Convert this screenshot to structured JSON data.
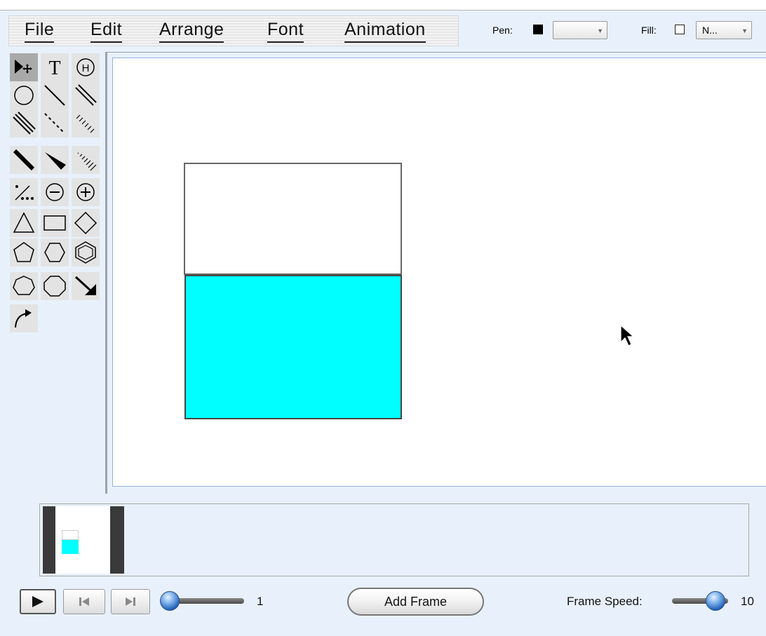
{
  "menu": {
    "file": "File",
    "edit": "Edit",
    "arrange": "Arrange",
    "font": "Font",
    "animation": "Animation"
  },
  "toolbar": {
    "pen_label": "Pen:",
    "pen_color": "#000000",
    "pen_style_value": "",
    "fill_label": "Fill:",
    "fill_color": "#ffffff",
    "fill_value": "N..."
  },
  "tools": [
    {
      "name": "select-tool-icon",
      "selected": true
    },
    {
      "name": "text-tool-icon",
      "glyph": "T"
    },
    {
      "name": "h-circle-icon",
      "glyph": "H"
    },
    {
      "name": "circle-tool-icon"
    },
    {
      "name": "line-thin-icon"
    },
    {
      "name": "line-double-icon"
    },
    {
      "name": "line-triple-icon"
    },
    {
      "name": "line-dashed-icon"
    },
    {
      "name": "line-hatched-icon"
    },
    {
      "name": "line-bold-icon"
    },
    {
      "name": "wedge-icon"
    },
    {
      "name": "wedge-hatched-icon"
    },
    {
      "name": "dots-icon"
    },
    {
      "name": "minus-circle-icon"
    },
    {
      "name": "plus-circle-icon"
    },
    {
      "name": "triangle-icon"
    },
    {
      "name": "rectangle-icon"
    },
    {
      "name": "diamond-icon"
    },
    {
      "name": "pentagon-icon"
    },
    {
      "name": "hexagon-icon"
    },
    {
      "name": "benzene-icon"
    },
    {
      "name": "heptagon-icon"
    },
    {
      "name": "octagon-icon"
    },
    {
      "name": "arrow-icon"
    },
    {
      "name": "curved-arrow-icon"
    }
  ],
  "canvas_shapes": {
    "top_fill": "#ffffff",
    "bottom_fill": "#00ffff"
  },
  "playback": {
    "frame_number": "1",
    "add_frame_label": "Add Frame",
    "frame_speed_label": "Frame Speed:",
    "frame_speed_value": "10"
  }
}
